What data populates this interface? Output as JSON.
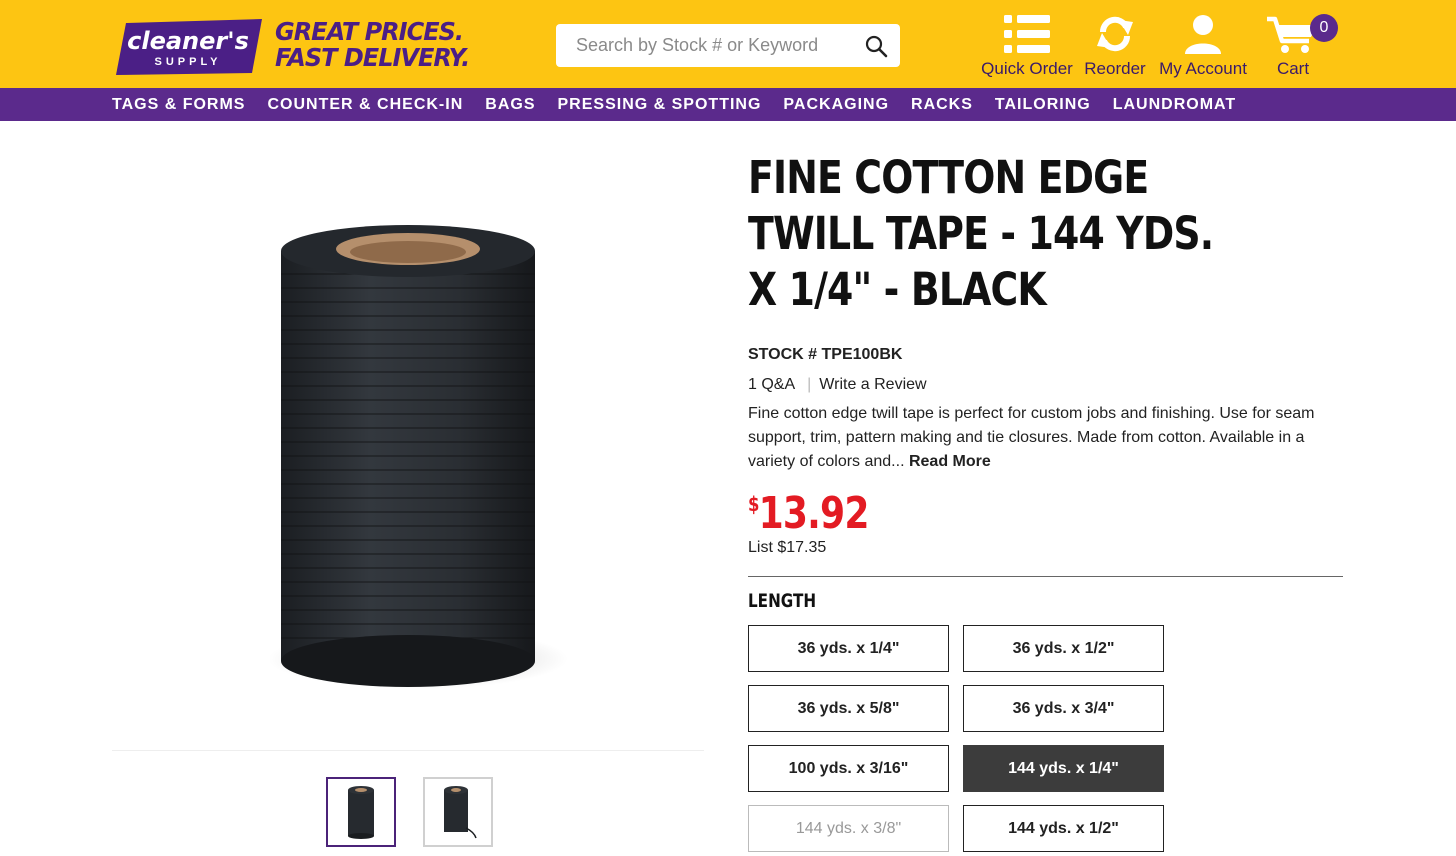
{
  "brand": {
    "logo_text": "cleaner's",
    "logo_sub": "SUPPLY",
    "tagline_line1": "GREAT PRICES.",
    "tagline_line2": "FAST DELIVERY."
  },
  "search": {
    "placeholder": "Search by Stock # or Keyword"
  },
  "header_actions": [
    {
      "label": "Quick Order",
      "icon": "list-icon"
    },
    {
      "label": "Reorder",
      "icon": "refresh-icon"
    },
    {
      "label": "My Account",
      "icon": "user-icon"
    },
    {
      "label": "Cart",
      "icon": "cart-icon",
      "badge": "0"
    }
  ],
  "nav": [
    "TAGS & FORMS",
    "COUNTER & CHECK-IN",
    "BAGS",
    "PRESSING & SPOTTING",
    "PACKAGING",
    "RACKS",
    "TAILORING",
    "LAUNDROMAT"
  ],
  "product": {
    "title": "FINE COTTON EDGE TWILL TAPE - 144 YDS. X 1/4\" - BLACK",
    "stock": "STOCK # TPE100BK",
    "qa": "1 Q&A",
    "review": "Write a Review",
    "description": "Fine cotton edge twill tape is perfect for custom jobs and finishing. Use for seam support, trim, pattern making and tie closures. Made from cotton. Available in a variety of colors and...",
    "read_more": "Read More",
    "price_symbol": "$",
    "price": "13.92",
    "list_price": "List $17.35",
    "option_label": "LENGTH",
    "options": [
      {
        "label": "36 yds. x 1/4\"",
        "state": "available"
      },
      {
        "label": "36 yds. x 1/2\"",
        "state": "available"
      },
      {
        "label": "36 yds. x 5/8\"",
        "state": "available"
      },
      {
        "label": "36 yds. x 3/4\"",
        "state": "available"
      },
      {
        "label": "100 yds. x 3/16\"",
        "state": "available"
      },
      {
        "label": "144 yds. x 1/4\"",
        "state": "selected"
      },
      {
        "label": "144 yds. x 3/8\"",
        "state": "disabled"
      },
      {
        "label": "144 yds. x 1/2\"",
        "state": "available"
      }
    ]
  },
  "colors": {
    "brand_yellow": "#fdc512",
    "brand_purple": "#5b2a8c",
    "price_red": "#e31b23"
  }
}
